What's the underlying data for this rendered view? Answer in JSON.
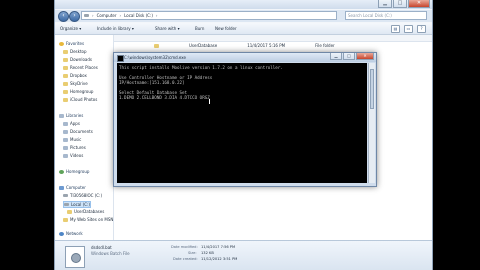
{
  "explorer": {
    "address_crumbs": [
      "Computer",
      "Local Disk (C:)"
    ],
    "search_placeholder": "Search Local Disk (C:)",
    "toolbar": {
      "organize": "Organize ▾",
      "include": "Include in library ▾",
      "share": "Share with ▾",
      "burn": "Burn",
      "newfolder": "New folder"
    },
    "nav": {
      "favorites_header": "Favorites",
      "favorites": [
        "Desktop",
        "Downloads",
        "Recent Places",
        "Dropbox",
        "SkyDrive",
        "Homegroup",
        "iCloud Photos"
      ],
      "libraries_header": "Libraries",
      "libraries": [
        "Apps",
        "Documents",
        "Music",
        "Pictures",
        "Videos"
      ],
      "homegroup": "Homegroup",
      "computer_header": "Computer",
      "computer_items": [
        "TI30568IOC (C:)",
        "Local (C:)",
        "UserDatabases",
        "My Web Sites on MSN"
      ],
      "network": "Network"
    },
    "content": {
      "file_name": "UserDatabase",
      "file_date": "11/4/2017 5:16 PM",
      "file_type": "File folder"
    },
    "details": {
      "name": "dsdsdl.bat",
      "type": "Windows Batch File",
      "date_modified_label": "Date modified:",
      "date_modified": "11/4/2017 7:56 PM",
      "size_label": "Size:",
      "size": "132 KB",
      "date_created_label": "Date created:",
      "date_created": "11/12/2012 3:51 PM"
    }
  },
  "console": {
    "title": "C:\\windows\\system32\\cmd.exe",
    "lines": [
      "This script installs Moolive version 1.7.2 on a linux controller.",
      "",
      "Use Controller Hostname or IP Address",
      "IP/Hostname:[151.168.0.22]",
      "",
      "Select Default Database Set",
      "1.DEMO 2.CELLBOND 3.DIA 4.DTCCO ORGZ"
    ]
  }
}
